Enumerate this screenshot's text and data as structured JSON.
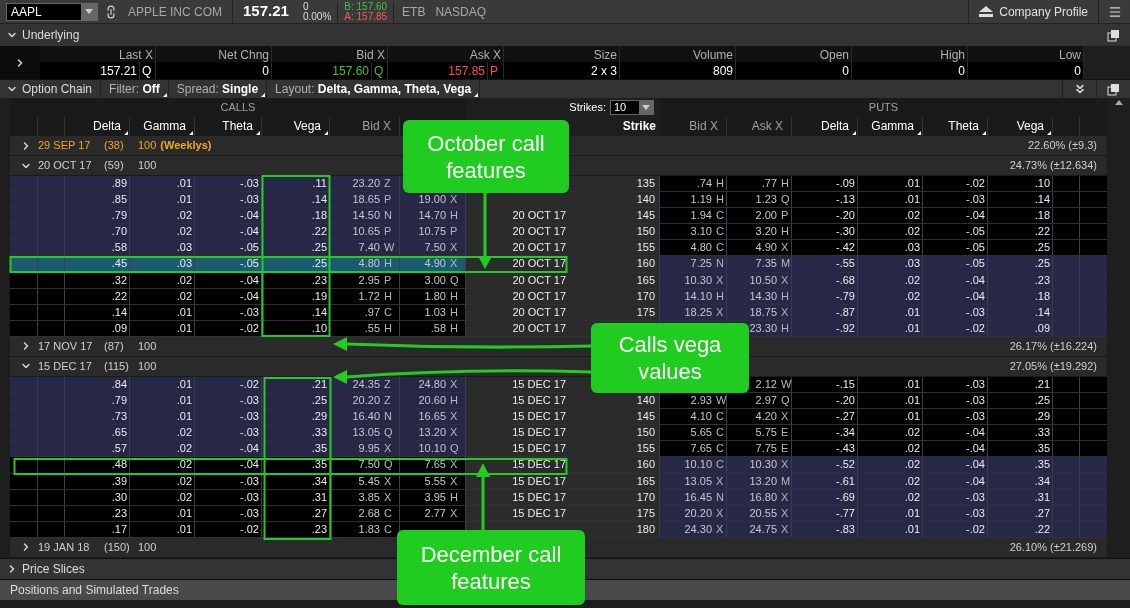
{
  "toolbar": {
    "symbol": "AAPL",
    "company": "APPLE INC COM",
    "last": "157.21",
    "net_change": "0",
    "percent_change": "0.00%",
    "bid": "B: 157.60",
    "ask": "A: 157.85",
    "borrow": "ETB",
    "exchange": "NASDAQ",
    "profile_button": "Company Profile"
  },
  "underlying": {
    "title": "Underlying",
    "expanded": true,
    "fields": [
      {
        "label": "Last X",
        "value": "157.21",
        "exchange": "Q"
      },
      {
        "label": "Net Chng",
        "value": "0"
      },
      {
        "label": "Bid X",
        "value": "157.60",
        "exchange": "Q",
        "color": "#3fc23f"
      },
      {
        "label": "Ask X",
        "value": "157.85",
        "exchange": "P",
        "color": "#ff4d4d"
      },
      {
        "label": "Size",
        "value": "2 x 3"
      },
      {
        "label": "Volume",
        "value": "809"
      },
      {
        "label": "Open",
        "value": "0"
      },
      {
        "label": "High",
        "value": "0"
      },
      {
        "label": "Low",
        "value": "0"
      }
    ]
  },
  "option_chain": {
    "title": "Option Chain",
    "expanded": true,
    "settings": [
      {
        "label": "Filter:",
        "value": "Off"
      },
      {
        "label": "Spread:",
        "value": "Single"
      },
      {
        "label": "Layout:",
        "value": "Delta, Gamma, Theta, Vega"
      }
    ],
    "calls_title": "CALLS",
    "puts_title": "PUTS",
    "strikes_label": "Strikes:",
    "strikes_value": "10",
    "call_columns": [
      {
        "label": "Delta",
        "kind": "greek"
      },
      {
        "label": "Gamma",
        "kind": "greek"
      },
      {
        "label": "Theta",
        "kind": "greek"
      },
      {
        "label": "Vega",
        "kind": "greek"
      },
      {
        "label": "Bid X",
        "kind": "price"
      }
    ],
    "strike_column": "Strike",
    "put_columns": [
      {
        "label": "Bid X",
        "kind": "price"
      },
      {
        "label": "Ask X",
        "kind": "price"
      },
      {
        "label": "Delta",
        "kind": "greek"
      },
      {
        "label": "Gamma",
        "kind": "greek"
      },
      {
        "label": "Theta",
        "kind": "greek"
      },
      {
        "label": "Vega",
        "kind": "greek"
      }
    ],
    "series": [
      {
        "date": "29 SEP 17",
        "days": "(38)",
        "multiplier": "100",
        "tag": "(Weeklys)",
        "weekly": true,
        "expanded": false,
        "iv": "22.60% (±9.3)"
      },
      {
        "date": "20 OCT 17",
        "days": "(59)",
        "multiplier": "100",
        "weekly": false,
        "expanded": true,
        "iv": "24.73% (±12.634)",
        "rows": [
          {
            "call": {
              "delta": ".89",
              "gamma": ".01",
              "theta": "-.03",
              "vega": ".11",
              "bid": "23.20",
              "bid_x": "Z"
            },
            "strike": "135",
            "put": {
              "bid": ".74",
              "bid_x": "H",
              "ask": ".77",
              "ask_x": "H",
              "delta": "-.09",
              "gamma": ".01",
              "theta": "-.02",
              "vega": ".10"
            },
            "call_itm": true,
            "put_itm": false,
            "selected": false
          },
          {
            "call": {
              "delta": ".85",
              "gamma": ".01",
              "theta": "-.03",
              "vega": ".14",
              "bid": "18.65",
              "bid_x": "P",
              "ask": "19.00",
              "ask_x": "X"
            },
            "strike": "140",
            "put": {
              "bid": "1.19",
              "bid_x": "H",
              "ask": "1.23",
              "ask_x": "Q",
              "delta": "-.13",
              "gamma": ".01",
              "theta": "-.03",
              "vega": ".14"
            },
            "call_itm": true,
            "put_itm": false,
            "selected": false
          },
          {
            "call": {
              "delta": ".79",
              "gamma": ".02",
              "theta": "-.04",
              "vega": ".18",
              "bid": "14.50",
              "bid_x": "N",
              "ask": "14.70",
              "ask_x": "H"
            },
            "exp": "20 OCT 17",
            "strike": "145",
            "put": {
              "bid": "1.94",
              "bid_x": "C",
              "ask": "2.00",
              "ask_x": "P",
              "delta": "-.20",
              "gamma": ".02",
              "theta": "-.04",
              "vega": ".18"
            },
            "call_itm": true,
            "put_itm": false,
            "selected": false
          },
          {
            "call": {
              "delta": ".70",
              "gamma": ".02",
              "theta": "-.04",
              "vega": ".22",
              "bid": "10.65",
              "bid_x": "P",
              "ask": "10.75",
              "ask_x": "P"
            },
            "exp": "20 OCT 17",
            "strike": "150",
            "put": {
              "bid": "3.10",
              "bid_x": "C",
              "ask": "3.20",
              "ask_x": "H",
              "delta": "-.30",
              "gamma": ".02",
              "theta": "-.05",
              "vega": ".22"
            },
            "call_itm": true,
            "put_itm": false,
            "selected": false
          },
          {
            "call": {
              "delta": ".58",
              "gamma": ".03",
              "theta": "-.05",
              "vega": ".25",
              "bid": "7.40",
              "bid_x": "W",
              "ask": "7.50",
              "ask_x": "X"
            },
            "exp": "20 OCT 17",
            "strike": "155",
            "put": {
              "bid": "4.80",
              "bid_x": "C",
              "ask": "4.90",
              "ask_x": "X",
              "delta": "-.42",
              "gamma": ".03",
              "theta": "-.05",
              "vega": ".25"
            },
            "call_itm": true,
            "put_itm": false,
            "selected": false
          },
          {
            "call": {
              "delta": ".45",
              "gamma": ".03",
              "theta": "-.05",
              "vega": ".25",
              "bid": "4.80",
              "bid_x": "H",
              "ask": "4.90",
              "ask_x": "X"
            },
            "exp": "20 OCT 17",
            "strike": "160",
            "put": {
              "bid": "7.25",
              "bid_x": "N",
              "ask": "7.35",
              "ask_x": "M",
              "delta": "-.55",
              "gamma": ".03",
              "theta": "-.05",
              "vega": ".25"
            },
            "call_itm": false,
            "put_itm": true,
            "selected": true
          },
          {
            "call": {
              "delta": ".32",
              "gamma": ".02",
              "theta": "-.04",
              "vega": ".23",
              "bid": "2.95",
              "bid_x": "P",
              "ask": "3.00",
              "ask_x": "Q"
            },
            "exp": "20 OCT 17",
            "strike": "165",
            "put": {
              "bid": "10.30",
              "bid_x": "X",
              "ask": "10.50",
              "ask_x": "X",
              "delta": "-.68",
              "gamma": ".02",
              "theta": "-.04",
              "vega": ".23"
            },
            "call_itm": false,
            "put_itm": true,
            "selected": false
          },
          {
            "call": {
              "delta": ".22",
              "gamma": ".02",
              "theta": "-.04",
              "vega": ".19",
              "bid": "1.72",
              "bid_x": "H",
              "ask": "1.80",
              "ask_x": "H"
            },
            "exp": "20 OCT 17",
            "strike": "170",
            "put": {
              "bid": "14.10",
              "bid_x": "H",
              "ask": "14.30",
              "ask_x": "H",
              "delta": "-.79",
              "gamma": ".02",
              "theta": "-.04",
              "vega": ".18"
            },
            "call_itm": false,
            "put_itm": true,
            "selected": false
          },
          {
            "call": {
              "delta": ".14",
              "gamma": ".01",
              "theta": "-.03",
              "vega": ".14",
              "bid": ".97",
              "bid_x": "C",
              "ask": "1.03",
              "ask_x": "H"
            },
            "exp": "20 OCT 17",
            "strike": "175",
            "put": {
              "bid": "18.25",
              "bid_x": "X",
              "ask": "18.75",
              "ask_x": "X",
              "delta": "-.87",
              "gamma": ".01",
              "theta": "-.03",
              "vega": ".14"
            },
            "call_itm": false,
            "put_itm": true,
            "selected": false
          },
          {
            "call": {
              "delta": ".09",
              "gamma": ".01",
              "theta": "-.02",
              "vega": ".10",
              "bid": ".55",
              "bid_x": "H",
              "ask": ".58",
              "ask_x": "H"
            },
            "exp": "20 OCT 17",
            "put": {
              "ask": "23.30",
              "ask_x": "H",
              "delta": "-.92",
              "gamma": ".01",
              "theta": "-.02",
              "vega": ".09"
            },
            "call_itm": false,
            "put_itm": true,
            "selected": false
          }
        ]
      },
      {
        "date": "17 NOV 17",
        "days": "(87)",
        "multiplier": "100",
        "weekly": false,
        "expanded": false,
        "iv": "26.17% (±16.224)"
      },
      {
        "date": "15 DEC 17",
        "days": "(115)",
        "multiplier": "100",
        "weekly": false,
        "expanded": true,
        "iv": "27.05% (±19.292)",
        "rows": [
          {
            "call": {
              "delta": ".84",
              "gamma": ".01",
              "theta": "-.02",
              "vega": ".21",
              "bid": "24.35",
              "bid_x": "Z",
              "ask": "24.80",
              "ask_x": "X"
            },
            "exp": "15 DEC 17",
            "put": {
              "ask": "2.12",
              "ask_x": "W",
              "delta": "-.15",
              "gamma": ".01",
              "theta": "-.03",
              "vega": ".21"
            },
            "call_itm": true,
            "put_itm": false,
            "selected": false
          },
          {
            "call": {
              "delta": ".79",
              "gamma": ".01",
              "theta": "-.03",
              "vega": ".25",
              "bid": "20.20",
              "bid_x": "Z",
              "ask": "20.60",
              "ask_x": "H"
            },
            "exp": "15 DEC 17",
            "strike": "140",
            "put": {
              "bid": "2.93",
              "bid_x": "W",
              "ask": "2.97",
              "ask_x": "Q",
              "delta": "-.20",
              "gamma": ".01",
              "theta": "-.03",
              "vega": ".25"
            },
            "call_itm": true,
            "put_itm": false,
            "selected": false
          },
          {
            "call": {
              "delta": ".73",
              "gamma": ".01",
              "theta": "-.03",
              "vega": ".29",
              "bid": "16.40",
              "bid_x": "N",
              "ask": "16.65",
              "ask_x": "X"
            },
            "exp": "15 DEC 17",
            "strike": "145",
            "put": {
              "bid": "4.10",
              "bid_x": "C",
              "ask": "4.20",
              "ask_x": "X",
              "delta": "-.27",
              "gamma": ".01",
              "theta": "-.03",
              "vega": ".29"
            },
            "call_itm": true,
            "put_itm": false,
            "selected": false
          },
          {
            "call": {
              "delta": ".65",
              "gamma": ".02",
              "theta": "-.03",
              "vega": ".33",
              "bid": "13.05",
              "bid_x": "Q",
              "ask": "13.20",
              "ask_x": "X"
            },
            "exp": "15 DEC 17",
            "strike": "150",
            "put": {
              "bid": "5.65",
              "bid_x": "C",
              "ask": "5.75",
              "ask_x": "E",
              "delta": "-.34",
              "gamma": ".02",
              "theta": "-.04",
              "vega": ".33"
            },
            "call_itm": true,
            "put_itm": false,
            "selected": false
          },
          {
            "call": {
              "delta": ".57",
              "gamma": ".02",
              "theta": "-.04",
              "vega": ".35",
              "bid": "9.95",
              "bid_x": "X",
              "ask": "10.10",
              "ask_x": "Q"
            },
            "exp": "15 DEC 17",
            "strike": "155",
            "put": {
              "bid": "7.65",
              "bid_x": "C",
              "ask": "7.75",
              "ask_x": "E",
              "delta": "-.43",
              "gamma": ".02",
              "theta": "-.04",
              "vega": ".35"
            },
            "call_itm": true,
            "put_itm": false,
            "selected": false
          },
          {
            "call": {
              "delta": ".48",
              "gamma": ".02",
              "theta": "-.04",
              "vega": ".35",
              "bid": "7.50",
              "bid_x": "Q",
              "ask": "7.65",
              "ask_x": "X"
            },
            "exp": "15 DEC 17",
            "strike": "160",
            "put": {
              "bid": "10.10",
              "bid_x": "C",
              "ask": "10.30",
              "ask_x": "X",
              "delta": "-.52",
              "gamma": ".02",
              "theta": "-.04",
              "vega": ".35"
            },
            "call_itm": false,
            "put_itm": true,
            "selected": false
          },
          {
            "call": {
              "delta": ".39",
              "gamma": ".02",
              "theta": "-.03",
              "vega": ".34",
              "bid": "5.45",
              "bid_x": "X",
              "ask": "5.55",
              "ask_x": "X"
            },
            "exp": "15 DEC 17",
            "strike": "165",
            "put": {
              "bid": "13.05",
              "bid_x": "X",
              "ask": "13.20",
              "ask_x": "M",
              "delta": "-.61",
              "gamma": ".02",
              "theta": "-.04",
              "vega": ".34"
            },
            "call_itm": false,
            "put_itm": true,
            "selected": false
          },
          {
            "call": {
              "delta": ".30",
              "gamma": ".02",
              "theta": "-.03",
              "vega": ".31",
              "bid": "3.85",
              "bid_x": "X",
              "ask": "3.95",
              "ask_x": "H"
            },
            "exp": "15 DEC 17",
            "strike": "170",
            "put": {
              "bid": "16.45",
              "bid_x": "N",
              "ask": "16.80",
              "ask_x": "X",
              "delta": "-.69",
              "gamma": ".02",
              "theta": "-.03",
              "vega": ".31"
            },
            "call_itm": false,
            "put_itm": true,
            "selected": false
          },
          {
            "call": {
              "delta": ".23",
              "gamma": ".01",
              "theta": "-.03",
              "vega": ".27",
              "bid": "2.68",
              "bid_x": "C",
              "ask": "2.77",
              "ask_x": "X"
            },
            "exp": "15 DEC 17",
            "strike": "175",
            "put": {
              "bid": "20.20",
              "bid_x": "X",
              "ask": "20.55",
              "ask_x": "X",
              "delta": "-.77",
              "gamma": ".01",
              "theta": "-.03",
              "vega": ".27"
            },
            "call_itm": false,
            "put_itm": true,
            "selected": false
          },
          {
            "call": {
              "delta": ".17",
              "gamma": ".01",
              "theta": "-.02",
              "vega": ".23",
              "bid": "1.83",
              "bid_x": "C"
            },
            "strike": "180",
            "put": {
              "bid": "24.30",
              "bid_x": "X",
              "ask": "24.75",
              "ask_x": "X",
              "delta": "-.83",
              "gamma": ".01",
              "theta": "-.02",
              "vega": ".22"
            },
            "call_itm": false,
            "put_itm": true,
            "selected": false
          }
        ]
      },
      {
        "date": "19 JAN 18",
        "days": "(150)",
        "multiplier": "100",
        "weekly": false,
        "expanded": false,
        "iv": "26.10% (±21.269)"
      }
    ]
  },
  "price_slices": {
    "title": "Price Slices",
    "expanded": false
  },
  "positions": {
    "title": "Positions and Simulated Trades"
  },
  "annotations": [
    {
      "text": "October call features"
    },
    {
      "text": "Calls vega values"
    },
    {
      "text": "December call features"
    }
  ]
}
